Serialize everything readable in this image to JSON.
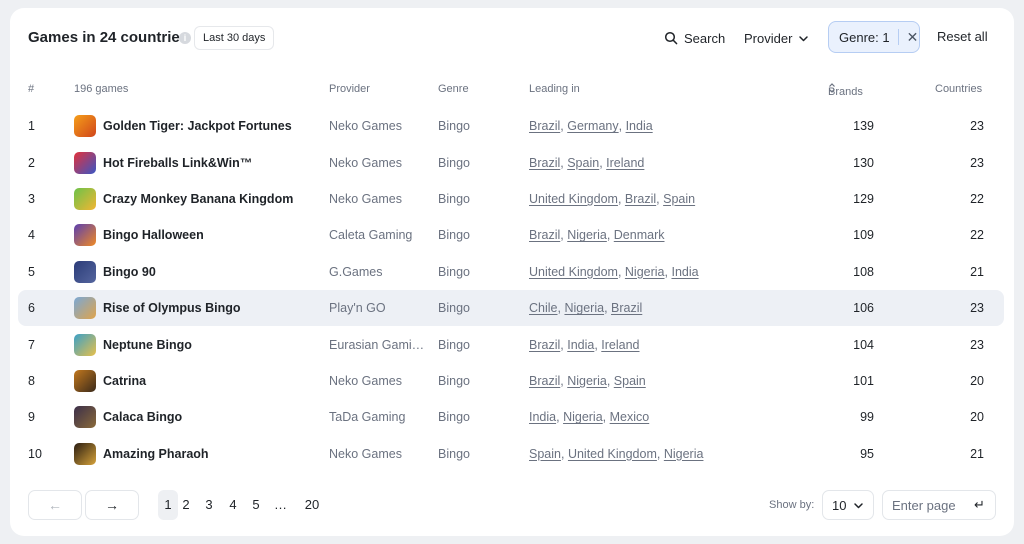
{
  "header": {
    "title": "Games in 24 countries",
    "period": "Last 30 days",
    "search_label": "Search",
    "provider_label": "Provider",
    "genre_filter_label": "Genre: 1",
    "reset_label": "Reset all"
  },
  "columns": {
    "num": "#",
    "games": "196 games",
    "provider": "Provider",
    "genre": "Genre",
    "leading": "Leading in",
    "brands": "Brands",
    "countries": "Countries"
  },
  "rows": [
    {
      "num": "1",
      "name": "Golden Tiger: Jackpot Fortunes",
      "provider": "Neko Games",
      "genre": "Bingo",
      "leading": [
        "Brazil",
        "Germany",
        "India"
      ],
      "brands": "139",
      "countries": "23",
      "thumb_colors": [
        "#f59f1a",
        "#d0451b"
      ]
    },
    {
      "num": "2",
      "name": "Hot Fireballs Link&Win™",
      "provider": "Neko Games",
      "genre": "Bingo",
      "leading": [
        "Brazil",
        "Spain",
        "Ireland"
      ],
      "brands": "130",
      "countries": "23",
      "thumb_colors": [
        "#e3313a",
        "#3a56c5"
      ]
    },
    {
      "num": "3",
      "name": "Crazy Monkey Banana Kingdom",
      "provider": "Neko Games",
      "genre": "Bingo",
      "leading": [
        "United Kingdom",
        "Brazil",
        "Spain"
      ],
      "brands": "129",
      "countries": "22",
      "thumb_colors": [
        "#6cc24a",
        "#f2b632"
      ]
    },
    {
      "num": "4",
      "name": "Bingo Halloween",
      "provider": "Caleta Gaming",
      "genre": "Bingo",
      "leading": [
        "Brazil",
        "Nigeria",
        "Denmark"
      ],
      "brands": "109",
      "countries": "22",
      "thumb_colors": [
        "#5a3fb0",
        "#f08a24"
      ]
    },
    {
      "num": "5",
      "name": "Bingo 90",
      "provider": "G.Games",
      "genre": "Bingo",
      "leading": [
        "United Kingdom",
        "Nigeria",
        "India"
      ],
      "brands": "108",
      "countries": "21",
      "thumb_colors": [
        "#2b3b78",
        "#55669e"
      ]
    },
    {
      "num": "6",
      "name": "Rise of Olympus Bingo",
      "provider": "Play'n GO",
      "genre": "Bingo",
      "leading": [
        "Chile",
        "Nigeria",
        "Brazil"
      ],
      "brands": "106",
      "countries": "23",
      "thumb_colors": [
        "#7aa8d6",
        "#e0a44a"
      ]
    },
    {
      "num": "7",
      "name": "Neptune Bingo",
      "provider": "Eurasian Gami…",
      "genre": "Bingo",
      "leading": [
        "Brazil",
        "India",
        "Ireland"
      ],
      "brands": "104",
      "countries": "23",
      "thumb_colors": [
        "#3aa0c8",
        "#e8c04a"
      ]
    },
    {
      "num": "8",
      "name": "Catrina",
      "provider": "Neko Games",
      "genre": "Bingo",
      "leading": [
        "Brazil",
        "Nigeria",
        "Spain"
      ],
      "brands": "101",
      "countries": "20",
      "thumb_colors": [
        "#c2781e",
        "#3b2a1a"
      ]
    },
    {
      "num": "9",
      "name": "Calaca Bingo",
      "provider": "TaDa Gaming",
      "genre": "Bingo",
      "leading": [
        "India",
        "Nigeria",
        "Mexico"
      ],
      "brands": "99",
      "countries": "20",
      "thumb_colors": [
        "#3b2f4a",
        "#8a6a3a"
      ]
    },
    {
      "num": "10",
      "name": "Amazing Pharaoh",
      "provider": "Neko Games",
      "genre": "Bingo",
      "leading": [
        "Spain",
        "United Kingdom",
        "Nigeria"
      ],
      "brands": "95",
      "countries": "21",
      "thumb_colors": [
        "#2a1d12",
        "#d6a23a"
      ]
    }
  ],
  "pagination": {
    "pages": [
      "1",
      "2",
      "3",
      "4",
      "5",
      "…",
      "20"
    ],
    "current": "1",
    "show_by_label": "Show by:",
    "show_by_value": "10",
    "page_input_placeholder": "Enter page"
  },
  "colors": {
    "accent_border": "#b6cdf3",
    "accent_bg": "#eaf1fd",
    "highlight_row": "#edf0f5"
  }
}
